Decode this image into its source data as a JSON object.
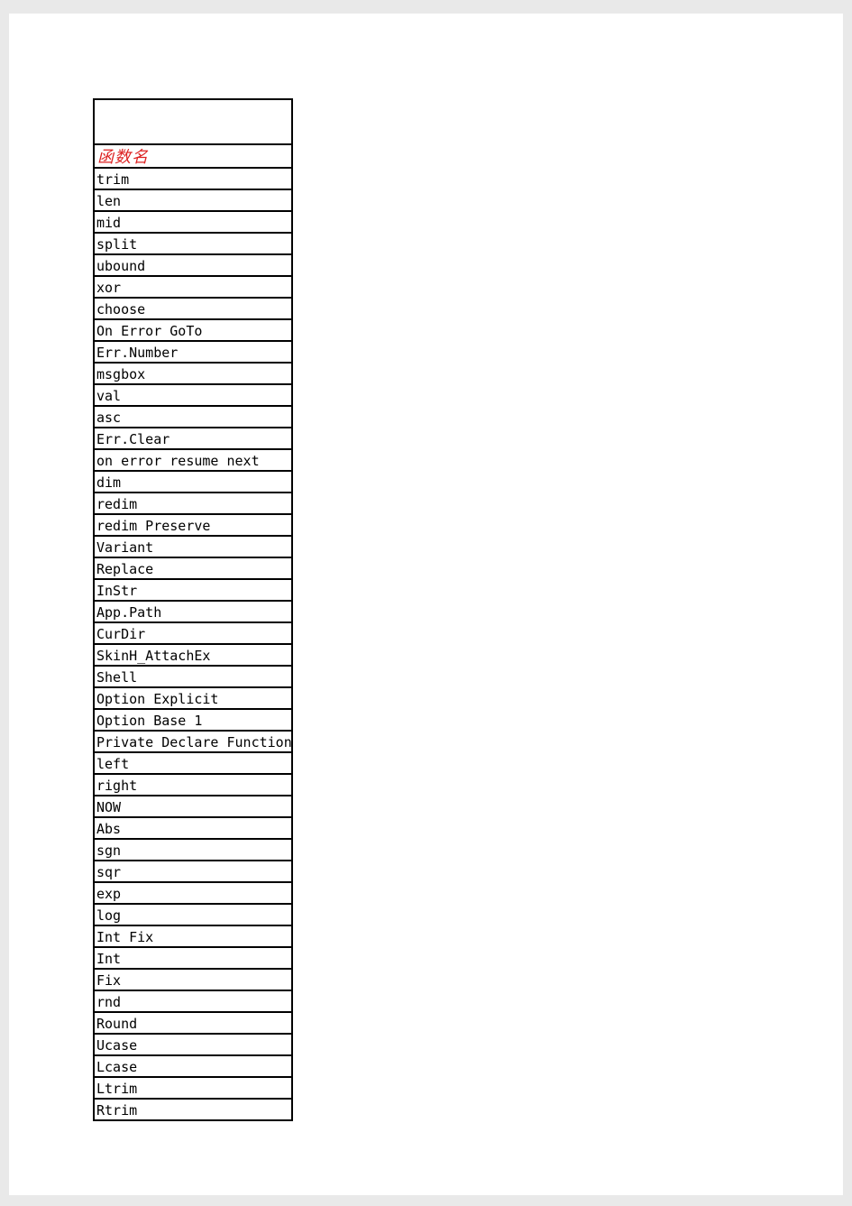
{
  "table": {
    "header": "函数名",
    "rows": [
      "trim",
      "len",
      "mid",
      "split",
      "ubound",
      "xor",
      "choose",
      "On Error GoTo",
      "Err.Number",
      "msgbox",
      "val",
      "asc",
      "Err.Clear",
      "on error resume next",
      "dim",
      "redim",
      "redim Preserve",
      "Variant",
      "Replace",
      "InStr",
      "App.Path",
      "CurDir",
      "SkinH_AttachEx",
      "Shell",
      "Option Explicit",
      "Option Base 1",
      "Private Declare Function",
      "left",
      "right",
      "NOW",
      "Abs",
      "sgn",
      "sqr",
      "exp",
      "log",
      "Int Fix",
      "Int",
      "Fix",
      "rnd",
      "Round",
      "Ucase",
      "Lcase",
      "Ltrim",
      "Rtrim"
    ]
  }
}
